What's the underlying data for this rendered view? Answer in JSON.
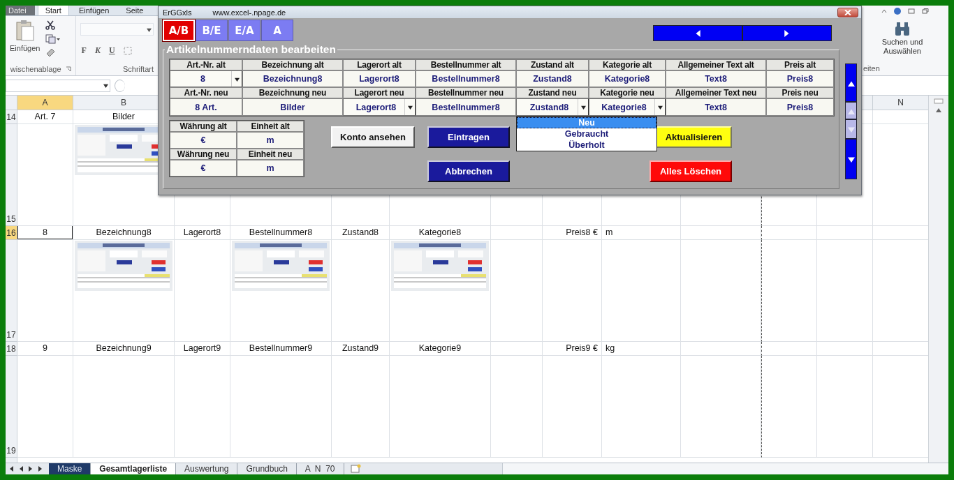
{
  "ribbon": {
    "tabs": [
      {
        "label": "Datei",
        "kind": "file",
        "selected": false
      },
      {
        "label": "Start",
        "kind": "tab",
        "selected": true
      },
      {
        "label": "Einfügen",
        "kind": "tab",
        "selected": false
      },
      {
        "label": "Seite",
        "kind": "tab",
        "selected": false
      }
    ],
    "paste_label": "Einfügen",
    "clipboard_group": "wischenablage",
    "font_buttons": [
      "F",
      "K",
      "U"
    ],
    "font_group": "Schriftart",
    "find_label": "Suchen und Auswählen",
    "editing_group": "eiten"
  },
  "column_headers": {
    "A": {
      "label": "A",
      "selected": true
    },
    "B": {
      "label": "B",
      "selected": false
    },
    "N": {
      "label": "N",
      "selected": false
    }
  },
  "rows": [
    {
      "number": "14",
      "kind": "short",
      "selected": false,
      "cells": {
        "A": {
          "text": "Art. 7"
        },
        "B": {
          "text": "Bilder"
        }
      }
    },
    {
      "number": "15",
      "kind": "tall",
      "selected": false
    },
    {
      "number": "16",
      "kind": "short",
      "selected": true,
      "cells": {
        "A": {
          "text": "8"
        },
        "B": {
          "text": "Bezeichnung8"
        },
        "C": {
          "text": "Lagerort8"
        },
        "D": {
          "text": "Bestellnummer8"
        },
        "E": {
          "text": "Zustand8"
        },
        "F": {
          "text": "Kategorie8"
        },
        "H": {
          "text": "Preis8 €"
        },
        "I": {
          "text": "m"
        }
      }
    },
    {
      "number": "17",
      "kind": "tall",
      "selected": false
    },
    {
      "number": "18",
      "kind": "short",
      "selected": false,
      "cells": {
        "A": {
          "text": "9"
        },
        "B": {
          "text": "Bezeichnung9"
        },
        "C": {
          "text": "Lagerort9"
        },
        "D": {
          "text": "Bestellnummer9"
        },
        "E": {
          "text": "Zustand9"
        },
        "F": {
          "text": "Kategorie9"
        },
        "H": {
          "text": "Preis9 €"
        },
        "I": {
          "text": "kg"
        }
      }
    },
    {
      "number": "19",
      "kind": "tall",
      "selected": false,
      "cells": {}
    }
  ],
  "sheet_tabs": [
    {
      "label": "Maske",
      "selected": false,
      "color": "#1f3a68"
    },
    {
      "label": "Gesamtlagerliste",
      "selected": true
    },
    {
      "label": "Auswertung",
      "selected": false
    },
    {
      "label": "Grundbuch",
      "selected": false
    },
    {
      "label": "A  N  70",
      "selected": false
    }
  ],
  "dialog": {
    "title": "ErGGxls",
    "url": "www.excel-.npage.de",
    "tabs": [
      {
        "label": "A/B",
        "selected": true
      },
      {
        "label": "B/E",
        "selected": false
      },
      {
        "label": "E/A",
        "selected": false
      },
      {
        "label": "A",
        "selected": false
      }
    ],
    "frame_title": "Artikelnummerndaten bearbeiten",
    "fields": [
      {
        "alt": {
          "label": "Art.-Nr. alt",
          "value": "8",
          "kind": "combo"
        },
        "neu": {
          "label": "Art.-Nr. neu",
          "value": "8 Art.",
          "kind": "text"
        }
      },
      {
        "alt": {
          "label": "Bezeichnung alt",
          "value": "Bezeichnung8",
          "kind": "text"
        },
        "neu": {
          "label": "Bezeichnung neu",
          "value": "Bilder",
          "kind": "text"
        }
      },
      {
        "alt": {
          "label": "Lagerort alt",
          "value": "Lagerort8",
          "kind": "text"
        },
        "neu": {
          "label": "Lagerort neu",
          "value": "Lagerort8",
          "kind": "combo"
        }
      },
      {
        "alt": {
          "label": "Bestellnummer alt",
          "value": "Bestellnummer8",
          "kind": "text"
        },
        "neu": {
          "label": "Bestellnummer neu",
          "value": "Bestellnummer8",
          "kind": "text"
        }
      },
      {
        "alt": {
          "label": "Zustand alt",
          "value": "Zustand8",
          "kind": "text"
        },
        "neu": {
          "label": "Zustand neu",
          "value": "Zustand8",
          "kind": "combo",
          "expanded": true,
          "options": [
            {
              "label": "Neu",
              "selected": true
            },
            {
              "label": "Gebraucht",
              "selected": false
            },
            {
              "label": "Überholt",
              "selected": false
            }
          ]
        }
      },
      {
        "alt": {
          "label": "Kategorie alt",
          "value": "Kategorie8",
          "kind": "text"
        },
        "neu": {
          "label": "Kategorie neu",
          "value": "Kategorie8",
          "kind": "combo"
        }
      },
      {
        "alt": {
          "label": "Allgemeiner Text alt",
          "value": "Text8",
          "kind": "text"
        },
        "neu": {
          "label": "Allgemeiner Text neu",
          "value": "Text8",
          "kind": "text"
        }
      },
      {
        "alt": {
          "label": "Preis alt",
          "value": "Preis8",
          "kind": "text"
        },
        "neu": {
          "label": "Preis neu",
          "value": "Preis8",
          "kind": "text"
        }
      }
    ],
    "units": [
      {
        "alt": {
          "label": "Währung alt",
          "value": "€"
        },
        "neu": {
          "label": "Währung neu",
          "value": "€"
        }
      },
      {
        "alt": {
          "label": "Einheit alt",
          "value": "m"
        },
        "neu": {
          "label": "Einheit neu",
          "value": "m"
        }
      }
    ],
    "button_columns": [
      [
        {
          "label": "Konto ansehen",
          "kind": "plain"
        }
      ],
      [
        {
          "label": "Eintragen",
          "kind": "primary"
        },
        {
          "label": "Abbrechen",
          "kind": "primary"
        }
      ],
      [
        {
          "label": "Aktualisieren",
          "kind": "warning"
        },
        {
          "label": "Alles Löschen",
          "kind": "danger"
        }
      ]
    ]
  }
}
